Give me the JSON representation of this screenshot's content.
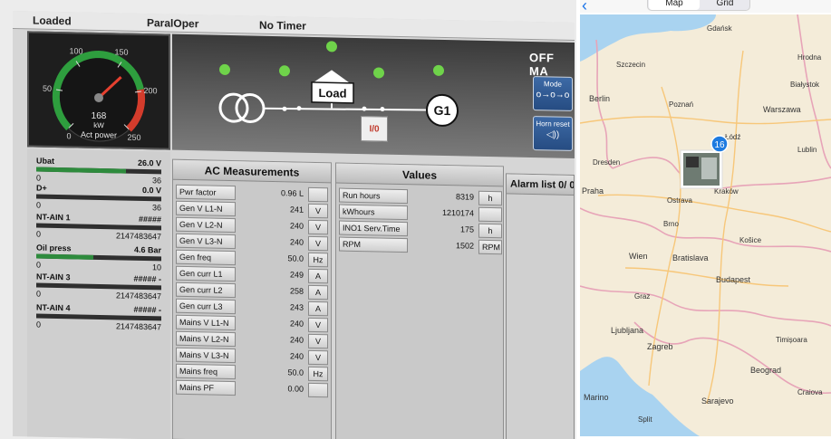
{
  "hmi": {
    "status": {
      "state": "Loaded",
      "mode_text": "ParalOper",
      "timer": "No Timer"
    },
    "gauge": {
      "scale": [
        "0",
        "50",
        "100",
        "150",
        "200",
        "250"
      ],
      "value": "168",
      "unit": "kW",
      "caption": "Act power",
      "level": 0.672
    },
    "single_line": {
      "load_label": "Load",
      "gen_label": "G1",
      "mode_label": "OFF MA",
      "io_button": "I/0"
    },
    "mode_buttons": [
      {
        "title": "Mode",
        "glyph": "o→o→o"
      },
      {
        "title": "Horn reset",
        "glyph": "◁))"
      }
    ],
    "analog_inputs": [
      {
        "name": "Ubat",
        "value": "26.0 V",
        "min": "0",
        "max": "36",
        "level": 0.72
      },
      {
        "name": "D+",
        "value": "0.0 V",
        "min": "0",
        "max": "36",
        "level": 0.0
      },
      {
        "name": "NT-AIN 1",
        "value": "#####",
        "min": "0",
        "max": "2147483647",
        "level": 0.0
      },
      {
        "name": "Oil press",
        "value": "4.6 Bar",
        "min": "0",
        "max": "10",
        "level": 0.46
      },
      {
        "name": "NT-AIN 3",
        "value": "##### -",
        "min": "0",
        "max": "2147483647",
        "level": 0.0
      },
      {
        "name": "NT-AIN 4",
        "value": "##### -",
        "min": "0",
        "max": "2147483647",
        "level": 0.0
      }
    ],
    "ac": {
      "title": "AC Measurements",
      "rows": [
        {
          "label": "Pwr factor",
          "value": "0.96 L",
          "unit": ""
        },
        {
          "label": "Gen V L1-N",
          "value": "241",
          "unit": "V"
        },
        {
          "label": "Gen V L2-N",
          "value": "240",
          "unit": "V"
        },
        {
          "label": "Gen V L3-N",
          "value": "240",
          "unit": "V"
        },
        {
          "label": "Gen freq",
          "value": "50.0",
          "unit": "Hz"
        },
        {
          "label": "Gen curr L1",
          "value": "249",
          "unit": "A"
        },
        {
          "label": "Gen curr L2",
          "value": "258",
          "unit": "A"
        },
        {
          "label": "Gen curr L3",
          "value": "243",
          "unit": "A"
        },
        {
          "label": "Mains V L1-N",
          "value": "240",
          "unit": "V"
        },
        {
          "label": "Mains V L2-N",
          "value": "240",
          "unit": "V"
        },
        {
          "label": "Mains V L3-N",
          "value": "240",
          "unit": "V"
        },
        {
          "label": "Mains freq",
          "value": "50.0",
          "unit": "Hz"
        },
        {
          "label": "Mains PF",
          "value": "0.00",
          "unit": ""
        }
      ]
    },
    "values": {
      "title": "Values",
      "rows": [
        {
          "label": "Run hours",
          "value": "8319",
          "unit": "h"
        },
        {
          "label": "kWhours",
          "value": "1210174",
          "unit": ""
        },
        {
          "label": "INO1 Serv.Time",
          "value": "175",
          "unit": "h"
        },
        {
          "label": "RPM",
          "value": "1502",
          "unit": "RPM"
        }
      ]
    },
    "alarm": {
      "title": "Alarm list 0/ 0"
    },
    "colors": {
      "gauge_green": "#2e9e3e",
      "gauge_red": "#d43c2c",
      "led_green": "#6fd34a",
      "button_blue": "#2e5a94"
    }
  },
  "map_view": {
    "tabs": [
      {
        "label": "Map",
        "active": true
      },
      {
        "label": "Grid",
        "active": false
      }
    ],
    "back_icon": "chevron-left-icon",
    "photo_cluster": {
      "count": "16"
    },
    "cities": [
      "Gdańsk",
      "Szczecin",
      "Hrodna",
      "Berlin",
      "Poznań",
      "Białystok",
      "Warszawa",
      "Łódź",
      "Lublin",
      "Dresden",
      "Praha",
      "Ostrava",
      "Kraków",
      "Brno",
      "Košice",
      "Wien",
      "Bratislava",
      "Graz",
      "Budapest",
      "Ljubljana",
      "Zagreb",
      "Timișoara",
      "Beograd",
      "Marino",
      "Sarajevo",
      "Craiova",
      "Split"
    ],
    "map_colors": {
      "land": "#f4ecd9",
      "sea": "#a9d3f0",
      "border": "#e7a4b8",
      "road": "#f7c77a",
      "badge": "#1e7be0"
    }
  }
}
